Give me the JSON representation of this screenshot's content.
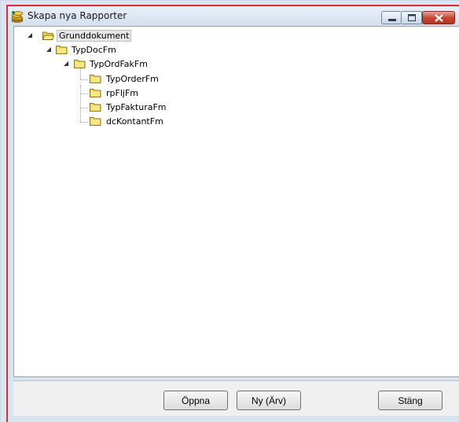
{
  "window": {
    "title": "Skapa nya Rapporter",
    "icon": "coins-icon",
    "controls": [
      "minimize-icon",
      "maximize-icon",
      "close-icon"
    ]
  },
  "tree": {
    "root": {
      "label": "Grunddokument",
      "expanded": true,
      "children": [
        {
          "label": "TypDocFm",
          "expanded": true,
          "children": [
            {
              "label": "TypOrdFakFm",
              "expanded": true,
              "children": [
                {
                  "label": "TypOrderFm"
                },
                {
                  "label": "rpFljFm"
                },
                {
                  "label": "TypFakturaFm"
                },
                {
                  "label": "dcKontantFm"
                }
              ]
            }
          ]
        }
      ]
    }
  },
  "buttons": {
    "open_label": "Öppna",
    "new_label": "Ny (Ärv)",
    "close_label": "Stäng"
  },
  "colors": {
    "title_bar": "#d4e0ee",
    "accent_red": "#d63030",
    "folder_yellow": "#f2d94e"
  }
}
